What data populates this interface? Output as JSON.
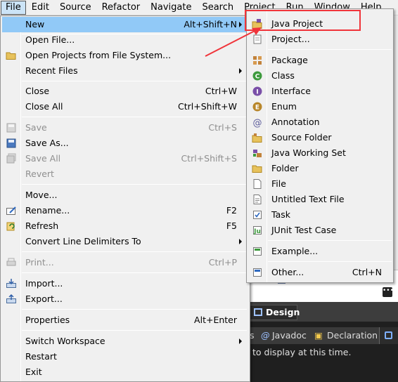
{
  "menubar": {
    "items": [
      "File",
      "Edit",
      "Source",
      "Refactor",
      "Navigate",
      "Search",
      "Project",
      "Run",
      "Window",
      "Help"
    ]
  },
  "file_menu": {
    "items": [
      {
        "label": "New",
        "shortcut": "Alt+Shift+N",
        "submenu": true,
        "highlight": true,
        "icon": "none"
      },
      {
        "label": "Open File...",
        "icon": "none"
      },
      {
        "label": "Open Projects from File System...",
        "icon": "folder-icon"
      },
      {
        "label": "Recent Files",
        "submenu": true,
        "icon": "none"
      },
      {
        "label": "Close",
        "shortcut": "Ctrl+W",
        "icon": "none"
      },
      {
        "label": "Close All",
        "shortcut": "Ctrl+Shift+W",
        "icon": "none"
      },
      {
        "label": "Save",
        "shortcut": "Ctrl+S",
        "disabled": true,
        "icon": "save-icon"
      },
      {
        "label": "Save As...",
        "icon": "save-as-icon"
      },
      {
        "label": "Save All",
        "shortcut": "Ctrl+Shift+S",
        "disabled": true,
        "icon": "save-all-icon"
      },
      {
        "label": "Revert",
        "disabled": true,
        "icon": "none"
      },
      {
        "label": "Move...",
        "icon": "none"
      },
      {
        "label": "Rename...",
        "shortcut": "F2",
        "icon": "rename-icon"
      },
      {
        "label": "Refresh",
        "shortcut": "F5",
        "icon": "refresh-icon"
      },
      {
        "label": "Convert Line Delimiters To",
        "submenu": true,
        "icon": "none"
      },
      {
        "label": "Print...",
        "shortcut": "Ctrl+P",
        "disabled": true,
        "icon": "print-icon"
      },
      {
        "label": "Import...",
        "icon": "import-icon"
      },
      {
        "label": "Export...",
        "icon": "export-icon"
      },
      {
        "label": "Properties",
        "shortcut": "Alt+Enter",
        "icon": "none"
      },
      {
        "label": "Switch Workspace",
        "submenu": true,
        "icon": "none"
      },
      {
        "label": "Restart",
        "icon": "none"
      },
      {
        "label": "Exit",
        "icon": "none"
      }
    ]
  },
  "new_menu": {
    "items": [
      {
        "label": "Java Project",
        "icon": "java-project-icon"
      },
      {
        "label": "Project...",
        "icon": "project-icon"
      },
      {
        "label": "Package",
        "icon": "package-icon"
      },
      {
        "label": "Class",
        "icon": "class-icon"
      },
      {
        "label": "Interface",
        "icon": "interface-icon"
      },
      {
        "label": "Enum",
        "icon": "enum-icon"
      },
      {
        "label": "Annotation",
        "icon": "annotation-icon"
      },
      {
        "label": "Source Folder",
        "icon": "source-folder-icon"
      },
      {
        "label": "Java Working Set",
        "icon": "working-set-icon"
      },
      {
        "label": "Folder",
        "icon": "folder-icon"
      },
      {
        "label": "File",
        "icon": "file-icon"
      },
      {
        "label": "Untitled Text File",
        "icon": "text-file-icon"
      },
      {
        "label": "Task",
        "icon": "task-icon"
      },
      {
        "label": "JUnit Test Case",
        "icon": "junit-icon"
      },
      {
        "label": "Example...",
        "icon": "example-icon"
      },
      {
        "label": "Other...",
        "shortcut": "Ctrl+N",
        "icon": "other-icon"
      }
    ]
  },
  "background": {
    "design_tab": "Design",
    "view_tabs": [
      "s",
      "Javadoc",
      "Declaration"
    ],
    "message": "to display at this time."
  },
  "colors": {
    "highlight": "#91c9f7",
    "annotation_red": "#f0343a",
    "menu_bg": "#f0f0f0"
  }
}
